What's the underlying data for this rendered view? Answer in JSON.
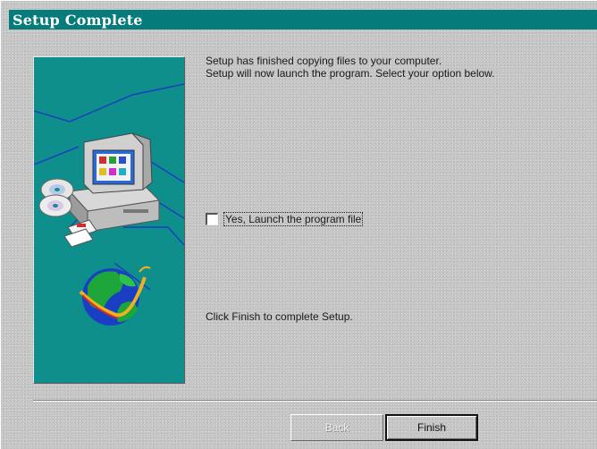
{
  "window": {
    "title": "Setup Complete"
  },
  "content": {
    "message_line1": "Setup has finished copying files to your computer.",
    "message_line2": "Setup will now launch the program. Select your option below.",
    "checkbox": {
      "label": "Yes, Launch the program file",
      "checked": false
    },
    "finish_instruction": "Click Finish to complete Setup."
  },
  "buttons": {
    "back_label": "Back",
    "back_enabled": false,
    "finish_label": "Finish"
  },
  "colors": {
    "titlebar": "#067b7b",
    "art_panel": "#0f8f8c",
    "dialog_face": "#c6c6c6"
  },
  "icons": [
    "computer-icon",
    "cd-disc-icon",
    "floppy-disk-icon",
    "globe-icon"
  ]
}
